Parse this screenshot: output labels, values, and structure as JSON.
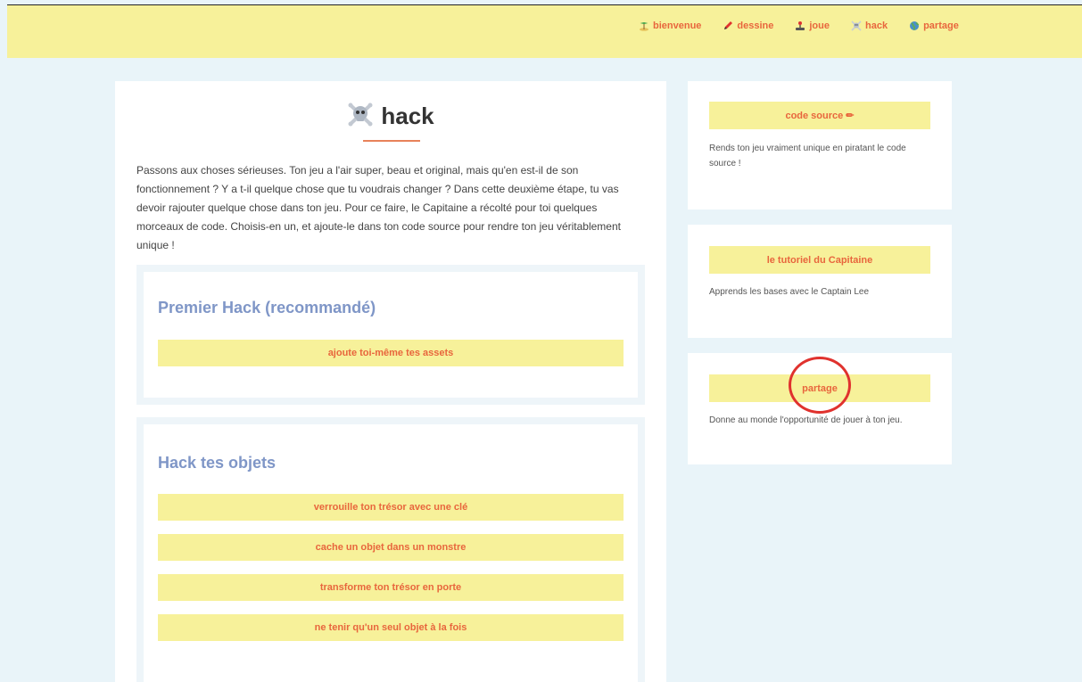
{
  "nav": {
    "items": [
      {
        "label": "bienvenue",
        "icon": "island-icon"
      },
      {
        "label": "dessine",
        "icon": "pencil-icon"
      },
      {
        "label": "joue",
        "icon": "joystick-icon"
      },
      {
        "label": "hack",
        "icon": "skull-crossbones-icon"
      },
      {
        "label": "partage",
        "icon": "globe-icon"
      }
    ]
  },
  "main": {
    "title": "hack",
    "intro": "Passons aux choses sérieuses. Ton jeu a l'air super, beau et original, mais qu'en est-il de son fonctionnement ? Y a t-il quelque chose que tu voudrais changer ? Dans cette deuxième étape, tu vas devoir rajouter quelque chose dans ton jeu. Pour ce faire, le Capitaine a récolté pour toi quelques morceaux de code. Choisis-en un, et ajoute-le dans ton code source pour rendre ton jeu véritablement unique  !",
    "sections": [
      {
        "title": "Premier Hack (recommandé)",
        "buttons": [
          "ajoute toi-même tes assets"
        ]
      },
      {
        "title": "Hack tes objets",
        "buttons": [
          "verrouille ton trésor avec une clé",
          "cache un objet dans un monstre",
          "transforme ton trésor en porte",
          "ne tenir qu'un seul objet à la fois"
        ]
      }
    ]
  },
  "sidebar": {
    "cards": [
      {
        "button": "code source ✏",
        "desc": "Rends ton jeu vraiment unique en piratant le code source !"
      },
      {
        "button": "le tutoriel du Capitaine",
        "desc": "Apprends les bases avec le Captain Lee"
      },
      {
        "button": "partage",
        "desc": "Donne au monde l'opportunité de jouer à ton jeu."
      }
    ]
  },
  "colors": {
    "accent": "#e8663d",
    "header_bg": "#f7f19a",
    "section_title": "#7f96c7",
    "highlight": "#e0322e"
  }
}
